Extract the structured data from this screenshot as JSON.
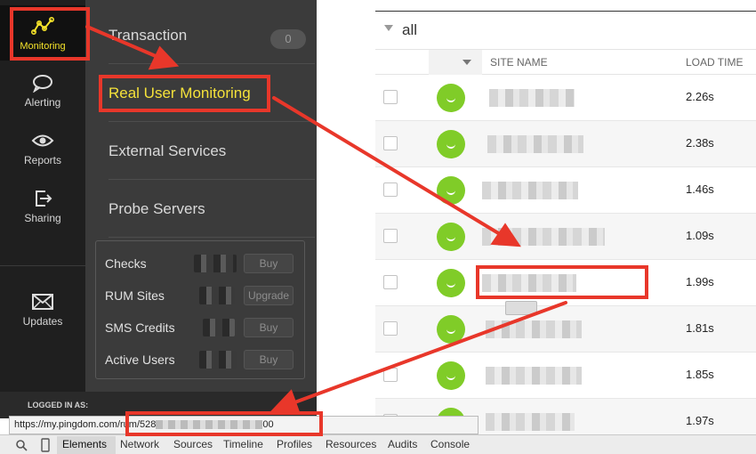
{
  "rail": {
    "items": [
      {
        "label": "Monitoring",
        "icon": "monitoring-icon"
      },
      {
        "label": "Alerting",
        "icon": "speech-bubble-icon"
      },
      {
        "label": "Reports",
        "icon": "eye-icon"
      },
      {
        "label": "Sharing",
        "icon": "share-icon"
      },
      {
        "label": "Updates",
        "icon": "envelope-icon"
      }
    ]
  },
  "submenu": {
    "items": [
      {
        "label": "Transaction",
        "badge": "0"
      },
      {
        "label": "Real User Monitoring"
      },
      {
        "label": "External Services"
      },
      {
        "label": "Probe Servers"
      }
    ],
    "stats": [
      {
        "label": "Checks",
        "button": "Buy"
      },
      {
        "label": "RUM Sites",
        "button": "Upgrade"
      },
      {
        "label": "SMS Credits",
        "button": "Buy"
      },
      {
        "label": "Active Users",
        "button": "Buy"
      }
    ],
    "logged_in_label": "LOGGED IN AS:"
  },
  "main": {
    "group_name": "all",
    "columns": {
      "site_name": "SITE NAME",
      "load_time": "LOAD TIME"
    },
    "rows": [
      {
        "load_time": "2.26s"
      },
      {
        "load_time": "2.38s"
      },
      {
        "load_time": "1.46s"
      },
      {
        "load_time": "1.09s"
      },
      {
        "load_time": "1.99s"
      },
      {
        "load_time": "1.81s"
      },
      {
        "load_time": "1.85s"
      },
      {
        "load_time": "1.97s"
      }
    ]
  },
  "status_url": {
    "prefix": "https://my.pingdom.com/rum/528",
    "suffix": "00"
  },
  "devtools": {
    "tabs": [
      "Elements",
      "Network",
      "Sources",
      "Timeline",
      "Profiles",
      "Resources",
      "Audits",
      "Console"
    ]
  },
  "colors": {
    "annotation": "#e8372a",
    "accent_yellow": "#f4e22a",
    "status_up": "#80cc28"
  }
}
